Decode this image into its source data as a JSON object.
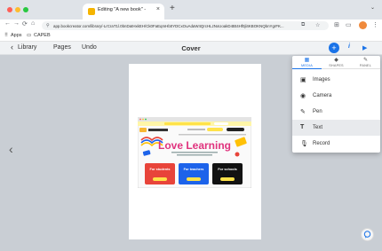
{
  "browser": {
    "tab_title": "Editing \"A new book\" - Book Creator",
    "tab_close": "×",
    "new_tab": "+",
    "url": "app.bookcreator.com/library/-LrCraT1l.0bnDatHxkEH/Ck0FaEqmHb0YDCxOuAdaW4QrcHLzNxUoakD4Bt4Hf0jl4KBOKNQbnYgrFK...",
    "icons": {
      "back": "←",
      "forward": "→",
      "reload": "⟳",
      "home": "⌂",
      "site_info": "⚲",
      "install": "⧉",
      "star": "☆",
      "extensions": "⊞",
      "sidepanel": "▭",
      "menu": "⋮",
      "tabs_chevron": "⌄"
    },
    "bookmarks": {
      "apps_icon": "⠿",
      "apps": "Apps",
      "folder_icon": "▭",
      "caps": "CAPEB"
    },
    "colors": {
      "close": "#ff5f57",
      "minimize": "#febc2e",
      "zoom": "#28c840"
    }
  },
  "app": {
    "nav": {
      "back_icon": "‹",
      "library": "Library",
      "pages": "Pages",
      "undo": "Undo"
    },
    "title": "Cover",
    "actions": {
      "add": "+",
      "info": "i",
      "play": "▶"
    },
    "prev_arrow": "‹",
    "next_arrow": "›",
    "chat_icon": "💬",
    "accent": "#1a73e8"
  },
  "add_menu": {
    "tabs": [
      {
        "label": "MEDIA",
        "icon": "▦"
      },
      {
        "label": "SHAPES",
        "icon": "◆"
      },
      {
        "label": "PANEL",
        "icon": "✎"
      }
    ],
    "items": [
      {
        "label": "Images",
        "icon": "▣"
      },
      {
        "label": "Camera",
        "icon": "◉"
      },
      {
        "label": "Pen",
        "icon": "✎"
      },
      {
        "label": "Text",
        "icon": "T"
      },
      {
        "label": "Record",
        "icon": "🎙"
      }
    ]
  },
  "page_thumbnail": {
    "banner_text": "Want to join the 2024 EDUCATOR PROGRAM?",
    "banner_cta": "Apply now",
    "brand": "BOOK CREATOR",
    "nav_cta": "Sign in",
    "nav_links": [
      "Resources",
      "Pricing",
      "About"
    ],
    "headline": "Love Learning",
    "subheadline": "Book Creator is the simple way to make digital books in the classroom.",
    "cards": [
      {
        "title": "For students",
        "button": "Sign in",
        "color": "#e8443a"
      },
      {
        "title": "For teachers",
        "button": "Learn more",
        "color": "#1d63ea"
      },
      {
        "title": "For schools",
        "button": "Learn more",
        "color": "#121212"
      }
    ]
  }
}
